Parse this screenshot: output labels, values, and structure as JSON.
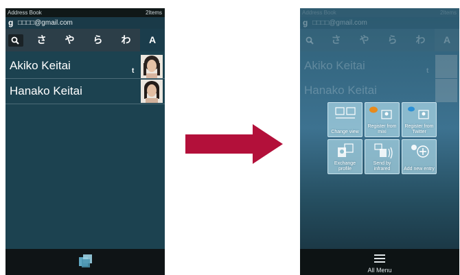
{
  "left_screen": {
    "statusbar": {
      "title": "Address Book",
      "count": "2Items"
    },
    "account": {
      "email": "□□□□@gmail.com"
    },
    "tabs": [
      "さ",
      "や",
      "ら",
      "わ",
      "A"
    ],
    "contacts": [
      {
        "name": "Akiko Keitai",
        "index_letter": "t"
      },
      {
        "name": "Hanako Keitai",
        "index_letter": ""
      }
    ]
  },
  "right_screen": {
    "statusbar": {
      "title": "Address Book",
      "count": "2Items"
    },
    "account": {
      "email": "□□□□@gmail.com"
    },
    "tabs": [
      "さ",
      "や",
      "ら",
      "わ",
      "A"
    ],
    "contacts": [
      {
        "name": "Akiko Keitai",
        "index_letter": "t"
      },
      {
        "name": "Hanako Keitai",
        "index_letter": ""
      }
    ],
    "menu": [
      {
        "label": "Change view",
        "icon": "change-view-icon"
      },
      {
        "label": "Register from mixi",
        "icon": "mixi-icon"
      },
      {
        "label": "Register from Twitter",
        "icon": "twitter-icon"
      },
      {
        "label": "Exchange profile",
        "icon": "exchange-profile-icon"
      },
      {
        "label": "Send by infrared",
        "icon": "infrared-icon"
      },
      {
        "label": "Add new entry",
        "icon": "add-entry-icon"
      }
    ],
    "bottom": {
      "label": "All Menu"
    }
  },
  "colors": {
    "arrow": "#b3103a",
    "screen_bg": "#1c4250",
    "menu_tile": "#aad7e6"
  }
}
